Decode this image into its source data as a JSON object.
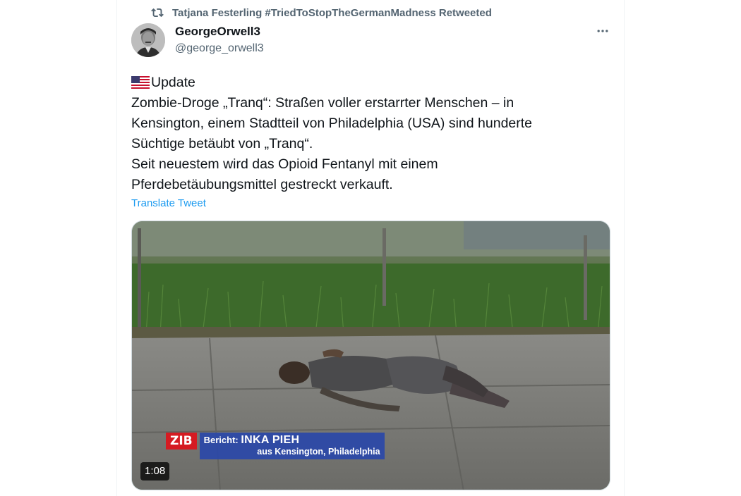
{
  "retweet": {
    "icon": "retweet-icon",
    "text": "Tatjana Festerling #TriedToStopTheGermanMadness Retweeted"
  },
  "author": {
    "name": "GeorgeOrwell3",
    "handle": "@george_orwell3"
  },
  "tweet": {
    "lines": [
      "Update",
      "Zombie-Droge „Tranq“: Straßen voller erstarrter Menschen – in",
      "Kensington, einem Stadtteil von Philadelphia (USA) sind hunderte",
      "Süchtige betäubt von „Tranq“.",
      "Seit neuestem wird das Opioid Fentanyl mit einem",
      "Pferdebetäubungsmittel gestreckt verkauft."
    ],
    "translate_label": "Translate Tweet"
  },
  "media": {
    "logo": "ZIB",
    "caption_prefix": "Bericht:",
    "caption_name": "INKA PIEH",
    "caption_sub": "aus Kensington, Philadelphia",
    "duration": "1:08"
  },
  "colors": {
    "link": "#1d9bf0",
    "secondary_text": "#536471",
    "zib_red": "#d51b22",
    "caption_blue": "#2a48a8"
  }
}
